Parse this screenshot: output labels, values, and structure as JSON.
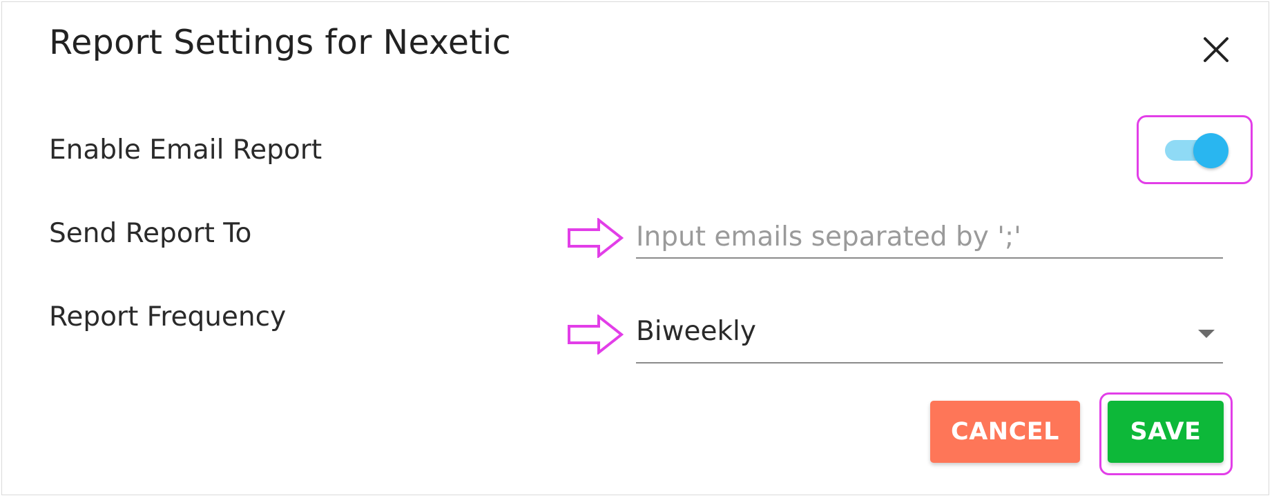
{
  "dialog": {
    "title": "Report Settings for Nexetic",
    "close_icon": "close-icon"
  },
  "form": {
    "enable_email_label": "Enable Email Report",
    "enable_email_on": true,
    "send_to_label": "Send Report To",
    "send_to_value": "",
    "send_to_placeholder": "Input emails separated by ';'",
    "frequency_label": "Report Frequency",
    "frequency_value": "Biweekly"
  },
  "actions": {
    "cancel_label": "CANCEL",
    "save_label": "SAVE"
  },
  "colors": {
    "toggle_track": "#8fdaf5",
    "toggle_knob": "#29b6f0",
    "cancel_bg": "#fe7658",
    "save_bg": "#0db839",
    "highlight": "#e23ee8"
  },
  "annotations": {
    "arrow_icon": "outline-right-arrow-icon"
  }
}
